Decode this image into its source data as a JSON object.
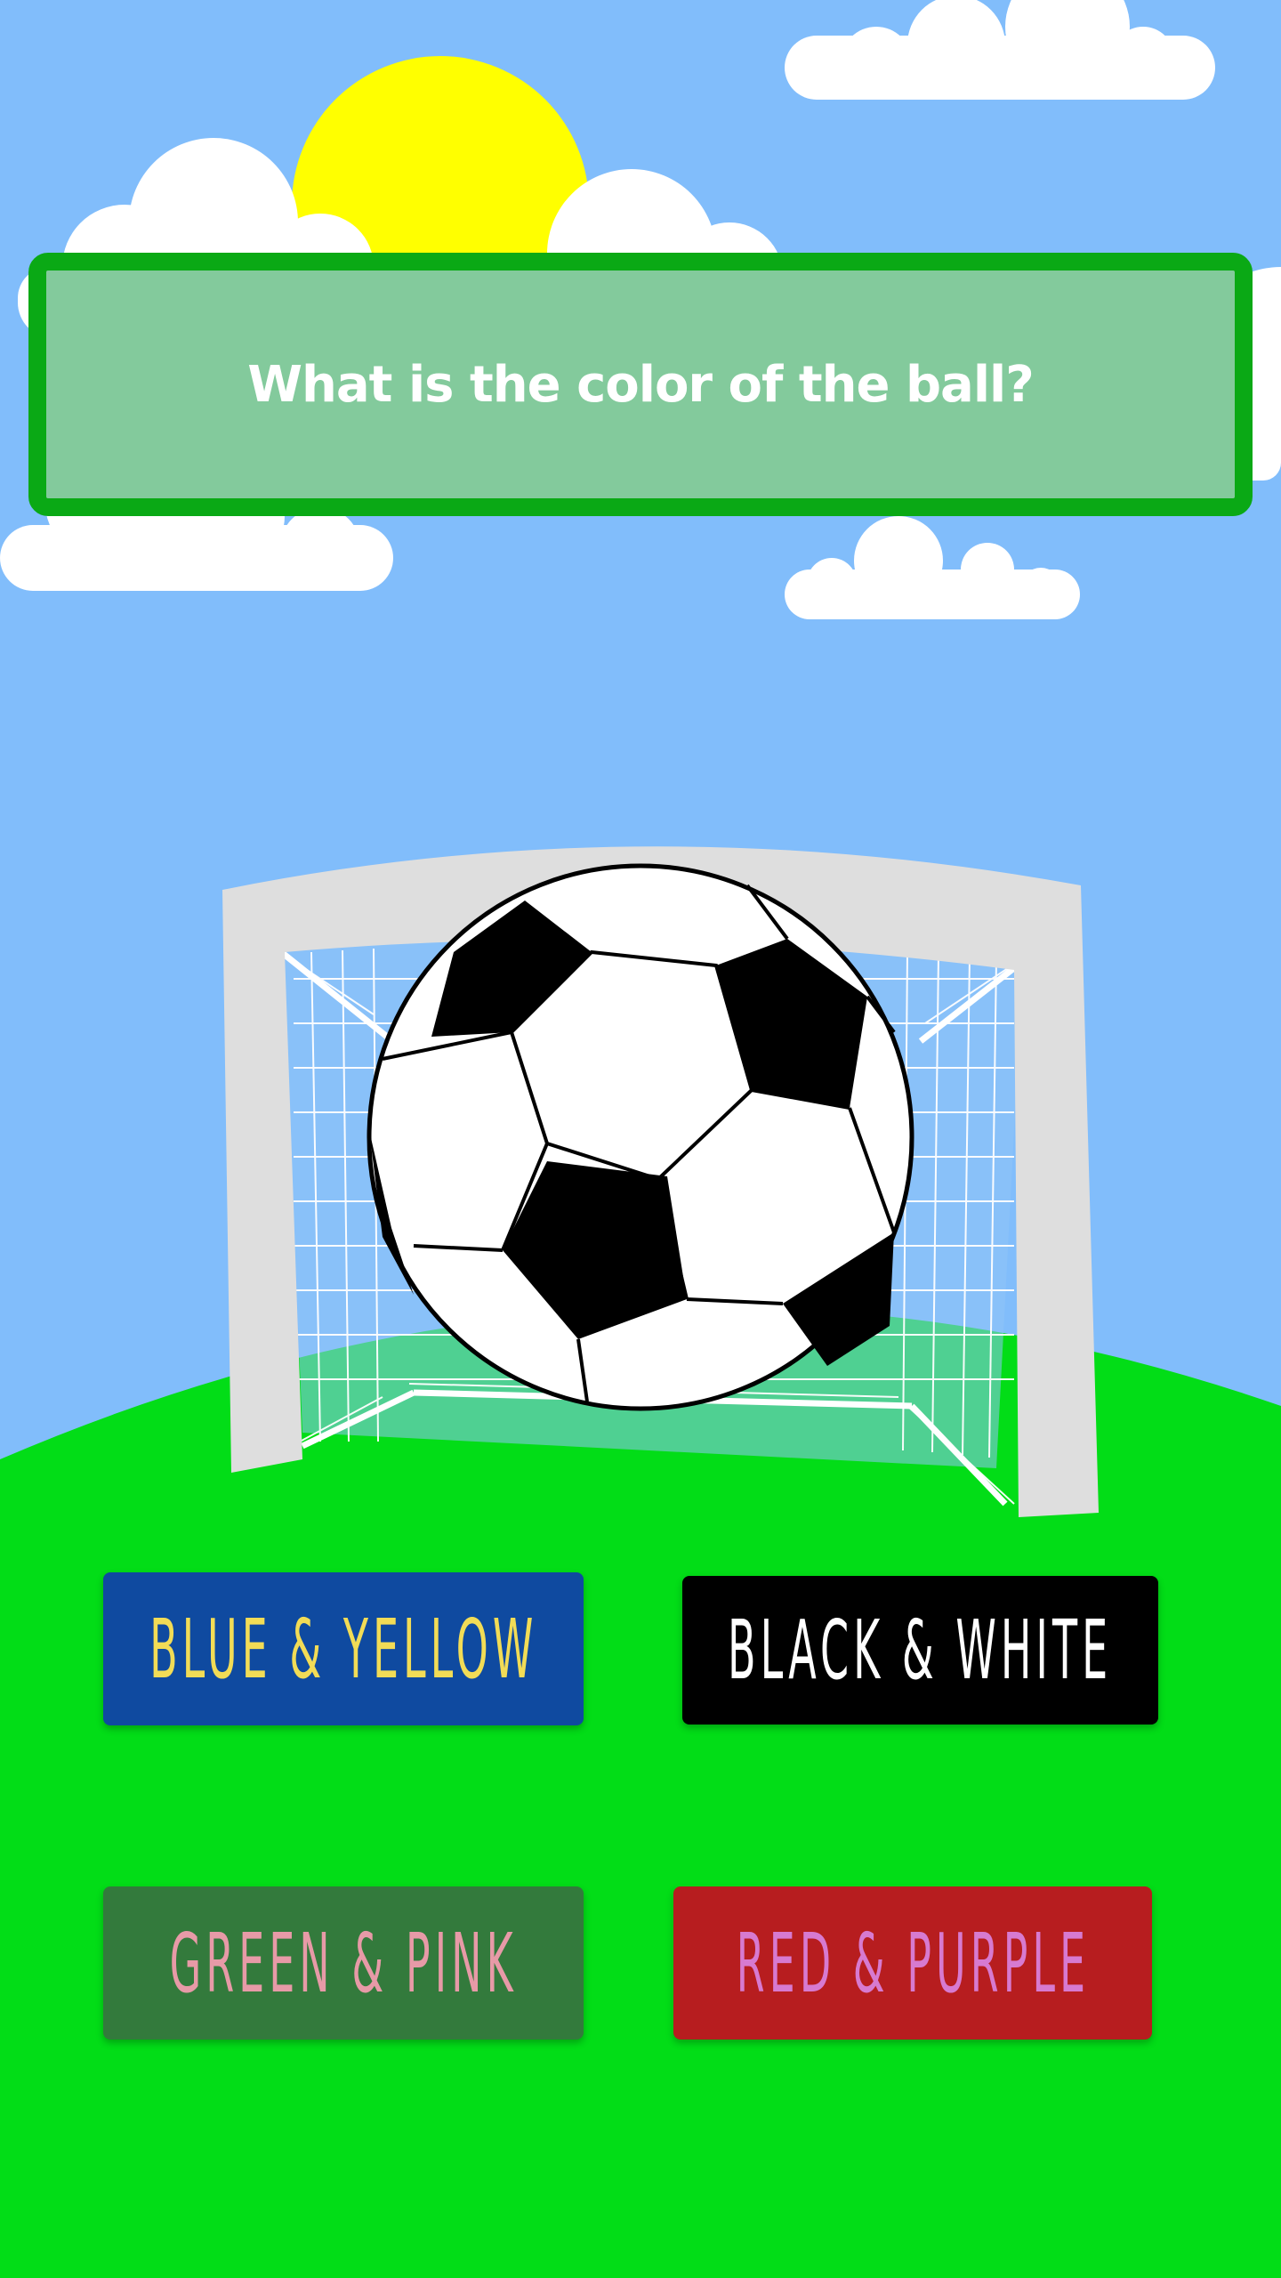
{
  "question": {
    "text": "What is the color of the ball?"
  },
  "answers": [
    {
      "label": "BLUE & YELLOW",
      "bg": "#0f4aa0",
      "fg": "#f2dc56"
    },
    {
      "label": "BLACK & WHITE",
      "bg": "#000000",
      "fg": "#ffffff"
    },
    {
      "label": "GREEN & PINK",
      "bg": "#337a3c",
      "fg": "#e79aa7"
    },
    {
      "label": "RED & PURPLE",
      "bg": "#b71d1f",
      "fg": "#d77ad0"
    }
  ],
  "scene": {
    "sky_color": "#81bdfb",
    "grass_color": "#02dd17",
    "sun_color": "#ffff00",
    "cloud_color": "#ffffff",
    "goal_frame_color": "#dedede",
    "icons": [
      "sun-icon",
      "cloud-icon",
      "soccer-goal-icon",
      "soccer-ball-icon"
    ]
  }
}
